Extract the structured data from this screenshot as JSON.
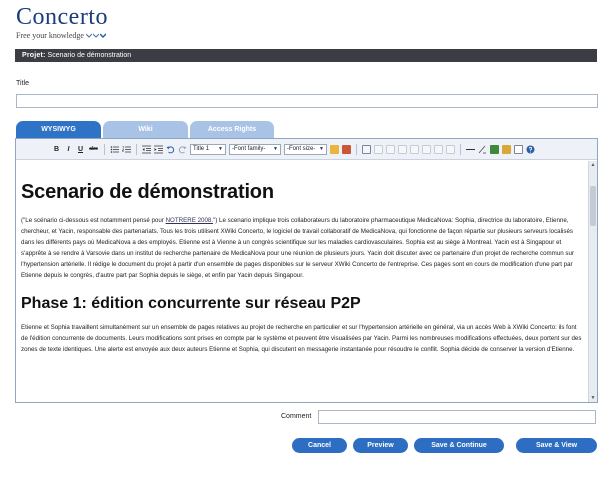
{
  "header": {
    "logo_title": "Concerto",
    "tagline": "Free your knowledge"
  },
  "project": {
    "label": "Projet:",
    "name": "Scenario de démonstration"
  },
  "title_field": {
    "label": "Title",
    "value": ""
  },
  "tabs": [
    {
      "label": "WYSIWYG",
      "active": true
    },
    {
      "label": "Wiki",
      "active": false
    },
    {
      "label": "Access Rights",
      "active": false
    }
  ],
  "toolbar": {
    "bold": "B",
    "italic": "I",
    "underline": "U",
    "strike": "abc",
    "style_select": "Title 1",
    "font_family_select": "-Font family-",
    "font_size_select": "-Font size-"
  },
  "document": {
    "heading1": "Scenario de démonstration",
    "intro_before_link": "(\"Le scénario ci-dessous est notamment pensé pour ",
    "intro_link": "NOTRERE 2008.",
    "intro_after_link": "\") Le scenario implique trois collaborateurs du laboratoire pharmaceutique MedicaNova: Sophia, directrice du laboratoire, Etienne, chercheur, et Yacin, responsable des partenariats. Tous les trois utilisent XWiki Concerto, le logiciel de travail collaboratif de MedicaNova, qui fonctionne de façon répartie sur plusieurs serveurs localisés dans les différents pays où MedicaNova a des employés. Etienne est à Vienne à un congrès scientifique sur les maladies cardiovasculaires. Sophia est au siège à Montreal. Yacin est à Singapour et s'apprête à se rendre à Varsovie dans un institut de recherche partenaire de MedicaNova pour une réunion de plusieurs jours. Yacin doit discuter avec ce partenaire d'un projet de recherche commun sur l'hypertension artérielle. Il rédige le document du projet à partir d'un ensemble de pages disponibles sur le serveur XWiki Concerto de l'entreprise. Ces pages sont en cours de modification d'une part par Etienne depuis le congrès, d'autre part par Sophia depuis le siège, et enfin par Yacin depuis Singapour.",
    "heading2": "Phase 1: édition concurrente sur réseau P2P",
    "para2": "Etienne et Sophia travaillent simultanément sur un ensemble de pages relatives au projet de recherche en particulier et sur l'hypertension artérielle en général, via un accès Web à XWiki Concerto: ils font de l'édition concurrente de documents. Leurs modifications sont prises en compte par le système et peuvent être visualisées par Yacin. Parmi les nombreuses modifications effectuées, deux portent sur des zones de texte identiques. Une alerte est envoyée aux deux auteurs Etienne et Sophia, qui discutent en messagerie instantanée pour résoudre le conflit. Sophia décide de conserver la version d'Etienne."
  },
  "comment": {
    "label": "Comment",
    "value": ""
  },
  "buttons": {
    "cancel": "Cancel",
    "preview": "Preview",
    "save_continue": "Save & Continue",
    "save_view": "Save & View"
  },
  "colors": {
    "primary_button": "#2d6ec2",
    "tab_active": "#2f73c7",
    "tab_inactive": "#a9c3e6",
    "project_bar": "#3c3c44",
    "logo": "#1a3e7a"
  }
}
